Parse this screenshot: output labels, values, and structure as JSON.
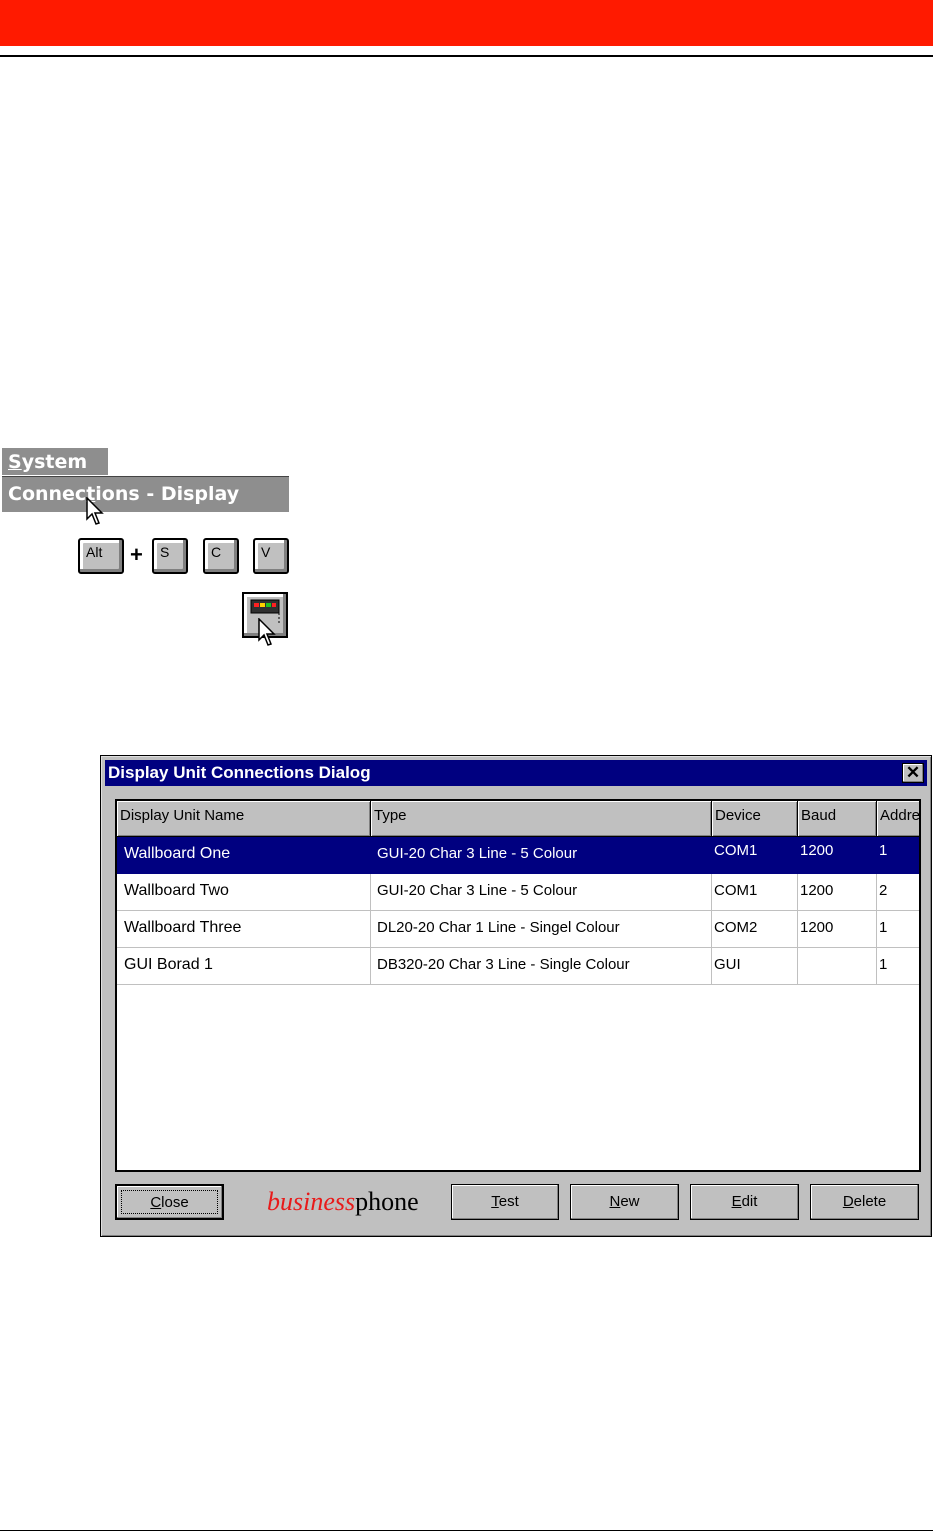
{
  "menu_path": {
    "menu": "System",
    "menu_mnemonic": "S",
    "menu_rest": "ystem",
    "item_pre": "Connec",
    "item_mnemonic": "t",
    "item_post": "ions - Display Units"
  },
  "shortcut_keys": {
    "alt": "Alt",
    "plus": "+",
    "s": "S",
    "c": "C",
    "v": "V"
  },
  "toolbar_icon": "display-unit-connections-icon",
  "dialog": {
    "title": "Display Unit Connections Dialog",
    "close_glyph": "✕",
    "columns": [
      "Display Unit Name",
      "Type",
      "Device",
      "Baud",
      "Address"
    ],
    "rows": [
      {
        "name": "Wallboard One",
        "type": "GUI-20 Char 3 Line - 5 Colour",
        "device": "COM1",
        "baud": "1200",
        "address": "1",
        "selected": true
      },
      {
        "name": "Wallboard Two",
        "type": "GUI-20 Char 3 Line - 5 Colour",
        "device": "COM1",
        "baud": "1200",
        "address": "2",
        "selected": false
      },
      {
        "name": "Wallboard Three",
        "type": "DL20-20 Char 1 Line - Singel Colour",
        "device": "COM2",
        "baud": "1200",
        "address": "1",
        "selected": false
      },
      {
        "name": "GUI Borad 1",
        "type": "DB320-20 Char 3 Line - Single Colour",
        "device": "GUI",
        "baud": "",
        "address": "1",
        "selected": false
      }
    ],
    "buttons": {
      "close_m": "C",
      "close_r": "lose",
      "test_m": "T",
      "test_r": "est",
      "new_m": "N",
      "new_r": "ew",
      "edit_m": "E",
      "edit_r": "dit",
      "delete_m": "D",
      "delete_r": "elete"
    },
    "logo": {
      "part1": "business",
      "part2": "phone"
    }
  },
  "colors": {
    "header_bar": "#ff1a00",
    "title_bar": "#000080",
    "selection": "#000080",
    "logo_accent": "#e81a1a"
  }
}
